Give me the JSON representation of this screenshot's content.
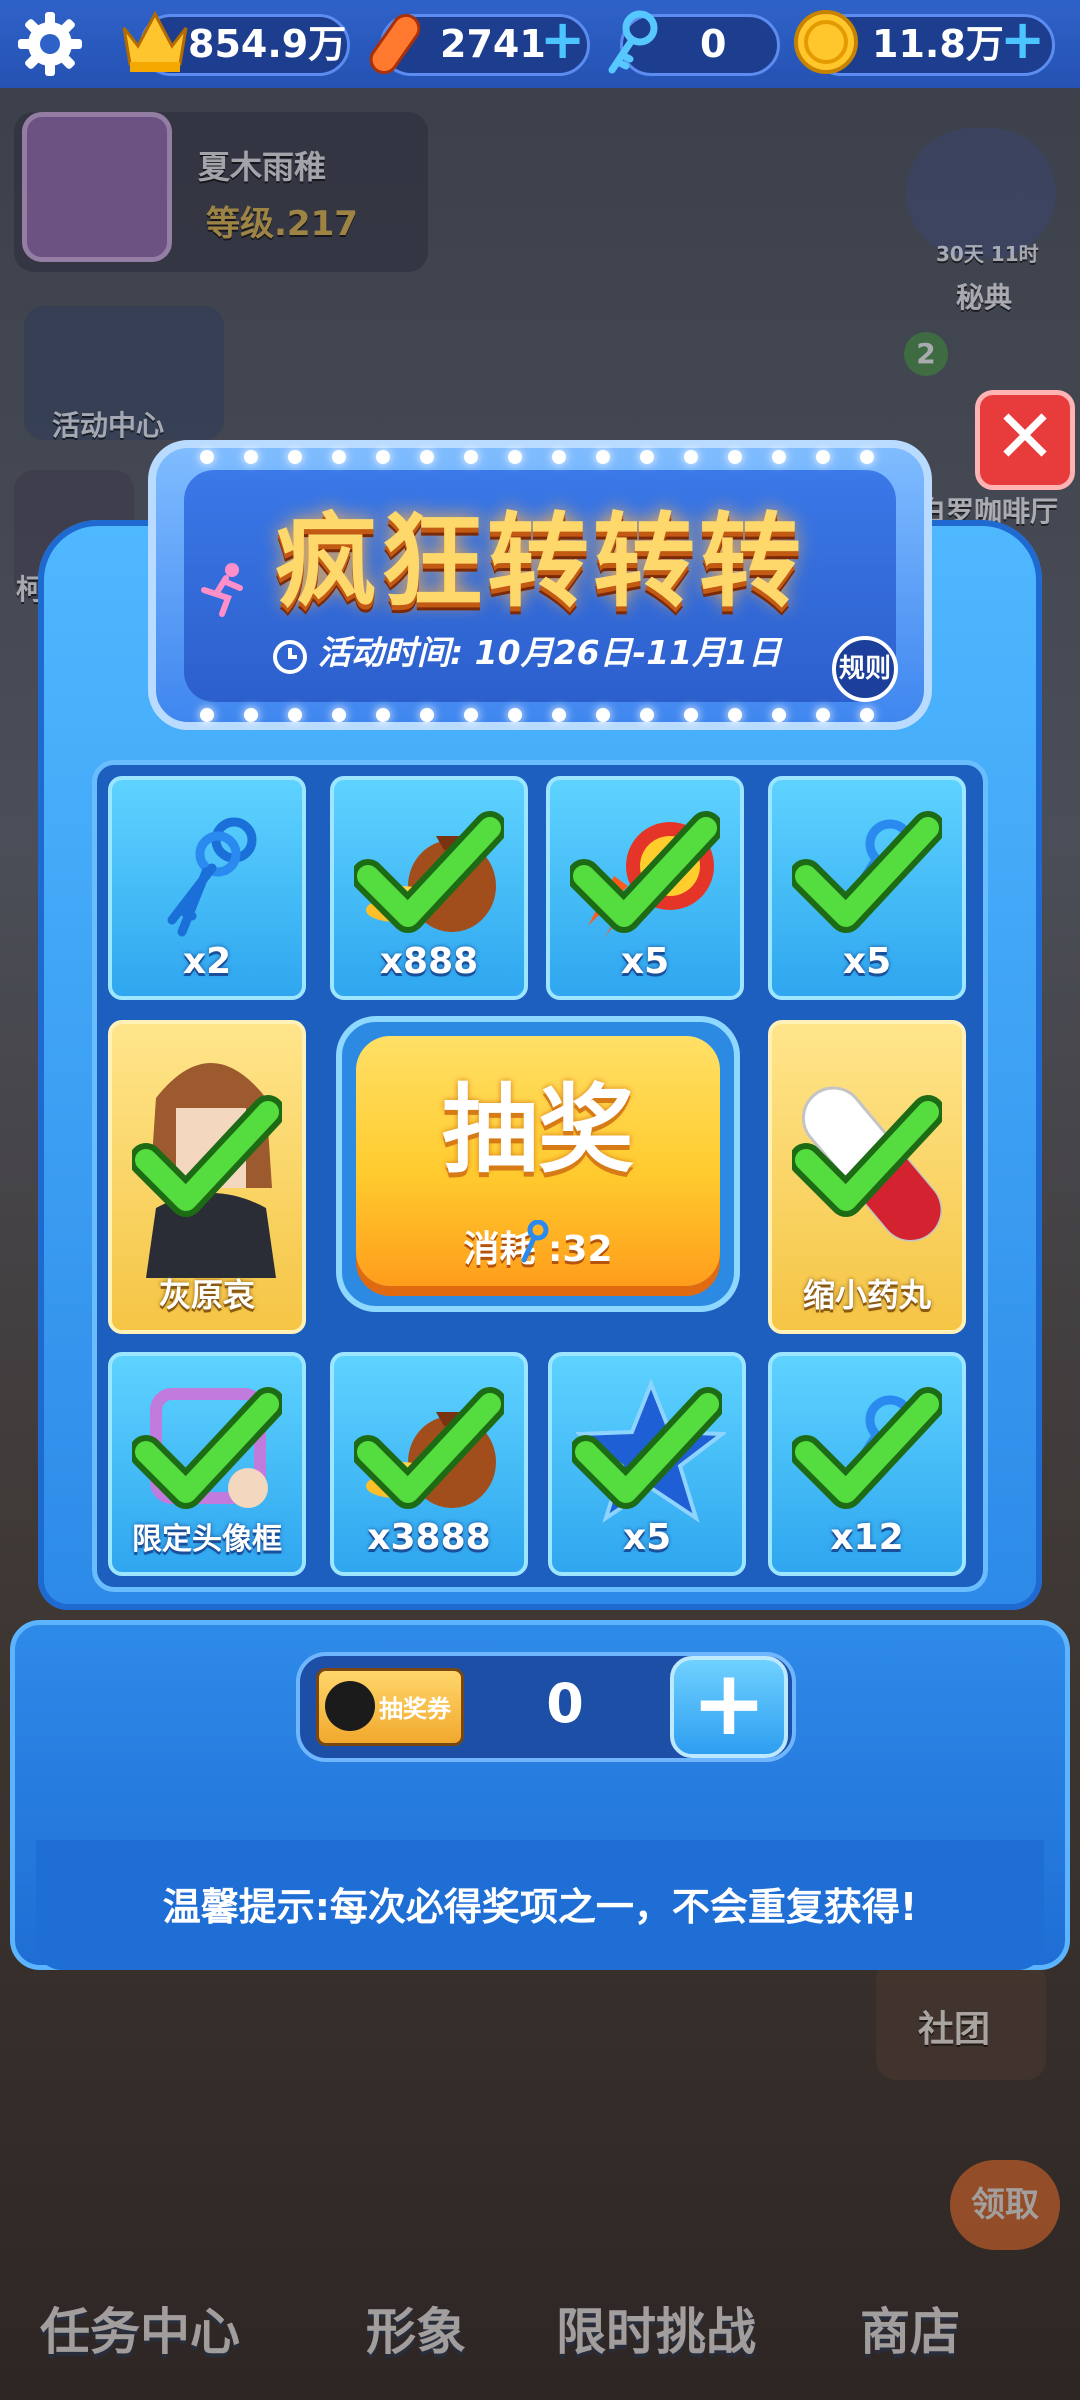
{
  "currencies": [
    {
      "icon": "crown-icon",
      "value": "854.9万"
    },
    {
      "icon": "hoverboard-icon",
      "value": "2741"
    },
    {
      "icon": "key-icon",
      "value": "0"
    },
    {
      "icon": "coin-icon",
      "value": "11.8万"
    }
  ],
  "player": {
    "name": "夏木雨稚",
    "level": "等级.217"
  },
  "side_left": {
    "activity": "活动中心",
    "collab": "柯南联动"
  },
  "side_right": {
    "timer": "30天 11时",
    "codex": "秘典",
    "badge": "2",
    "cafe": "白罗咖啡厅",
    "club": "社团"
  },
  "popup": {
    "title": "疯狂转转转",
    "event_time": "活动时间: 10月26日-11月1日",
    "rules": "规则",
    "close": "✕",
    "prizes": [
      {
        "label": "x2",
        "icon": "key-bundle-icon",
        "claimed": false
      },
      {
        "label": "x888",
        "icon": "coin-bag-icon",
        "claimed": true
      },
      {
        "label": "x5",
        "icon": "rocket-icon",
        "claimed": true
      },
      {
        "label": "x5",
        "icon": "key-icon",
        "claimed": true
      },
      {
        "label": "灰原哀",
        "icon": "character-icon",
        "claimed": true
      },
      {
        "label": "缩小药丸",
        "icon": "pill-icon",
        "claimed": true
      },
      {
        "label": "限定头像框",
        "icon": "avatar-frame-icon",
        "claimed": true
      },
      {
        "label": "x3888",
        "icon": "coin-bag-icon",
        "claimed": true
      },
      {
        "label": "x5",
        "icon": "star-icon",
        "claimed": true
      },
      {
        "label": "x12",
        "icon": "key-icon",
        "claimed": true
      }
    ],
    "draw": {
      "label": "抽奖",
      "cost": "消耗 :32"
    },
    "ticket": {
      "name": "抽奖券",
      "count": "0"
    },
    "tip": "温馨提示:每次必得奖项之一，不会重复获得!"
  },
  "nav": [
    {
      "label": "任务中心"
    },
    {
      "label": "形象"
    },
    {
      "label": "限时挑战"
    },
    {
      "label": "商店",
      "badge": "领取"
    }
  ],
  "colors": {
    "accent": "#2d8ae8",
    "gold": "#ffcb2e",
    "check": "#4cd43a",
    "close": "#e83b3b"
  }
}
